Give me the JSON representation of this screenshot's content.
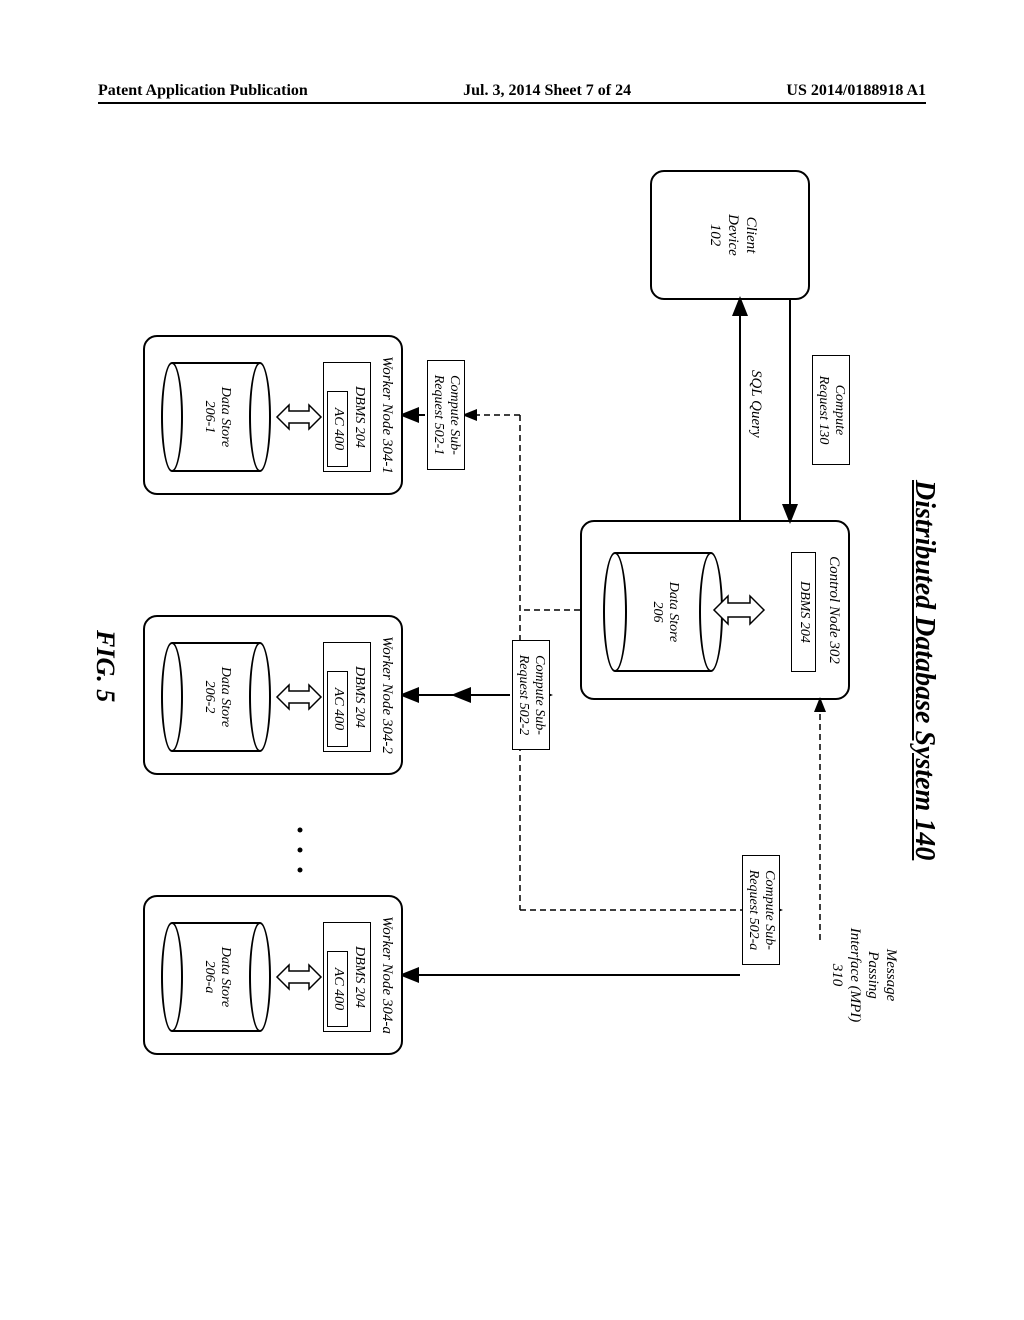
{
  "header": {
    "left": "Patent Application Publication",
    "center": "Jul. 3, 2014  Sheet 7 of 24",
    "right": "US 2014/0188918 A1"
  },
  "title": "Distributed Database System 140",
  "figure_label": "FIG. 5",
  "client": {
    "line1": "Client",
    "line2": "Device",
    "line3": "102"
  },
  "compute_request": {
    "line1": "Compute",
    "line2": "Request 130"
  },
  "sql_query": "SQL Query",
  "mpi": {
    "line1": "Message",
    "line2": "Passing",
    "line3": "Interface (MPI)",
    "line4": "310"
  },
  "control_node": {
    "title": "Control Node 302",
    "dbms": "DBMS 204",
    "datastore": {
      "line1": "Data Store",
      "line2": "206"
    }
  },
  "sub_requests": {
    "r1": {
      "line1": "Compute Sub-",
      "line2": "Request 502-1"
    },
    "r2": {
      "line1": "Compute Sub-",
      "line2": "Request 502-2"
    },
    "ra": {
      "line1": "Compute Sub-",
      "line2": "Request 502-a"
    }
  },
  "worker_common": {
    "dbms": "DBMS 204",
    "ac": "AC 400"
  },
  "workers": {
    "w1": {
      "title": "Worker Node 304-1",
      "ds1": "Data Store",
      "ds2": "206-1"
    },
    "w2": {
      "title": "Worker Node 304-2",
      "ds1": "Data Store",
      "ds2": "206-2"
    },
    "wa": {
      "title": "Worker Node 304-a",
      "ds1": "Data Store",
      "ds2": "206-a"
    }
  }
}
